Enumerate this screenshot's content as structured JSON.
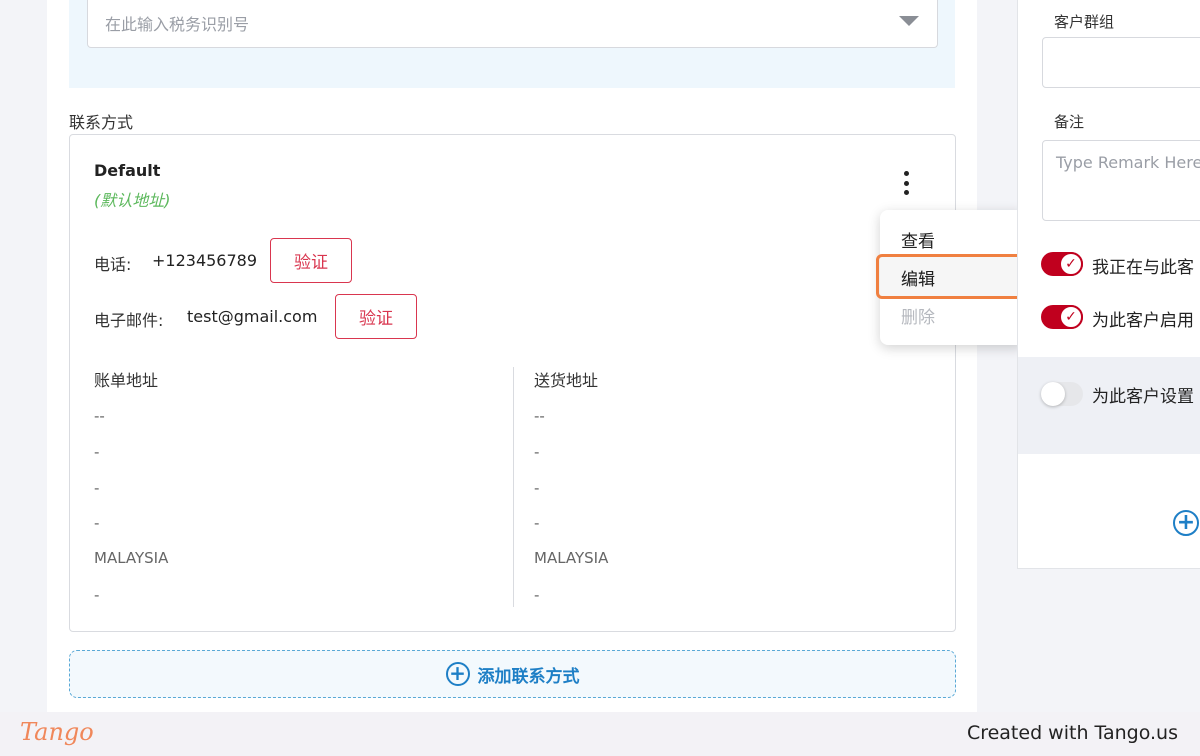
{
  "tax": {
    "placeholder": "在此输入税务识别号"
  },
  "contact_section": {
    "label": "联系方式"
  },
  "contact": {
    "name": "Default",
    "default_tag": "(默认地址)",
    "phone_label": "电话:",
    "phone_value": "+123456789",
    "email_label": "电子邮件:",
    "email_value": "test@gmail.com",
    "verify_label": "验证",
    "billing": {
      "title": "账单地址",
      "lines": [
        "--",
        "-",
        "-",
        "-",
        "MALAYSIA",
        "-"
      ]
    },
    "shipping": {
      "title": "送货地址",
      "lines": [
        "--",
        "-",
        "-",
        "-",
        "MALAYSIA",
        "-"
      ]
    }
  },
  "menu": {
    "view": "查看",
    "edit": "编辑",
    "delete": "删除"
  },
  "add_contact": {
    "label": "添加联系方式"
  },
  "right_panel": {
    "group_label": "客户群组",
    "remark_label": "备注",
    "remark_placeholder": "Type Remark Here",
    "toggle1_label": "我正在与此客",
    "toggle2_label": "为此客户启用",
    "toggle3_label": "为此客户设置"
  },
  "footer": {
    "logo": "Tango",
    "credit": "Created with Tango.us"
  },
  "colors": {
    "accent_red": "#c0001e",
    "link_blue": "#1e7fc6",
    "highlight_orange": "#f08040"
  }
}
